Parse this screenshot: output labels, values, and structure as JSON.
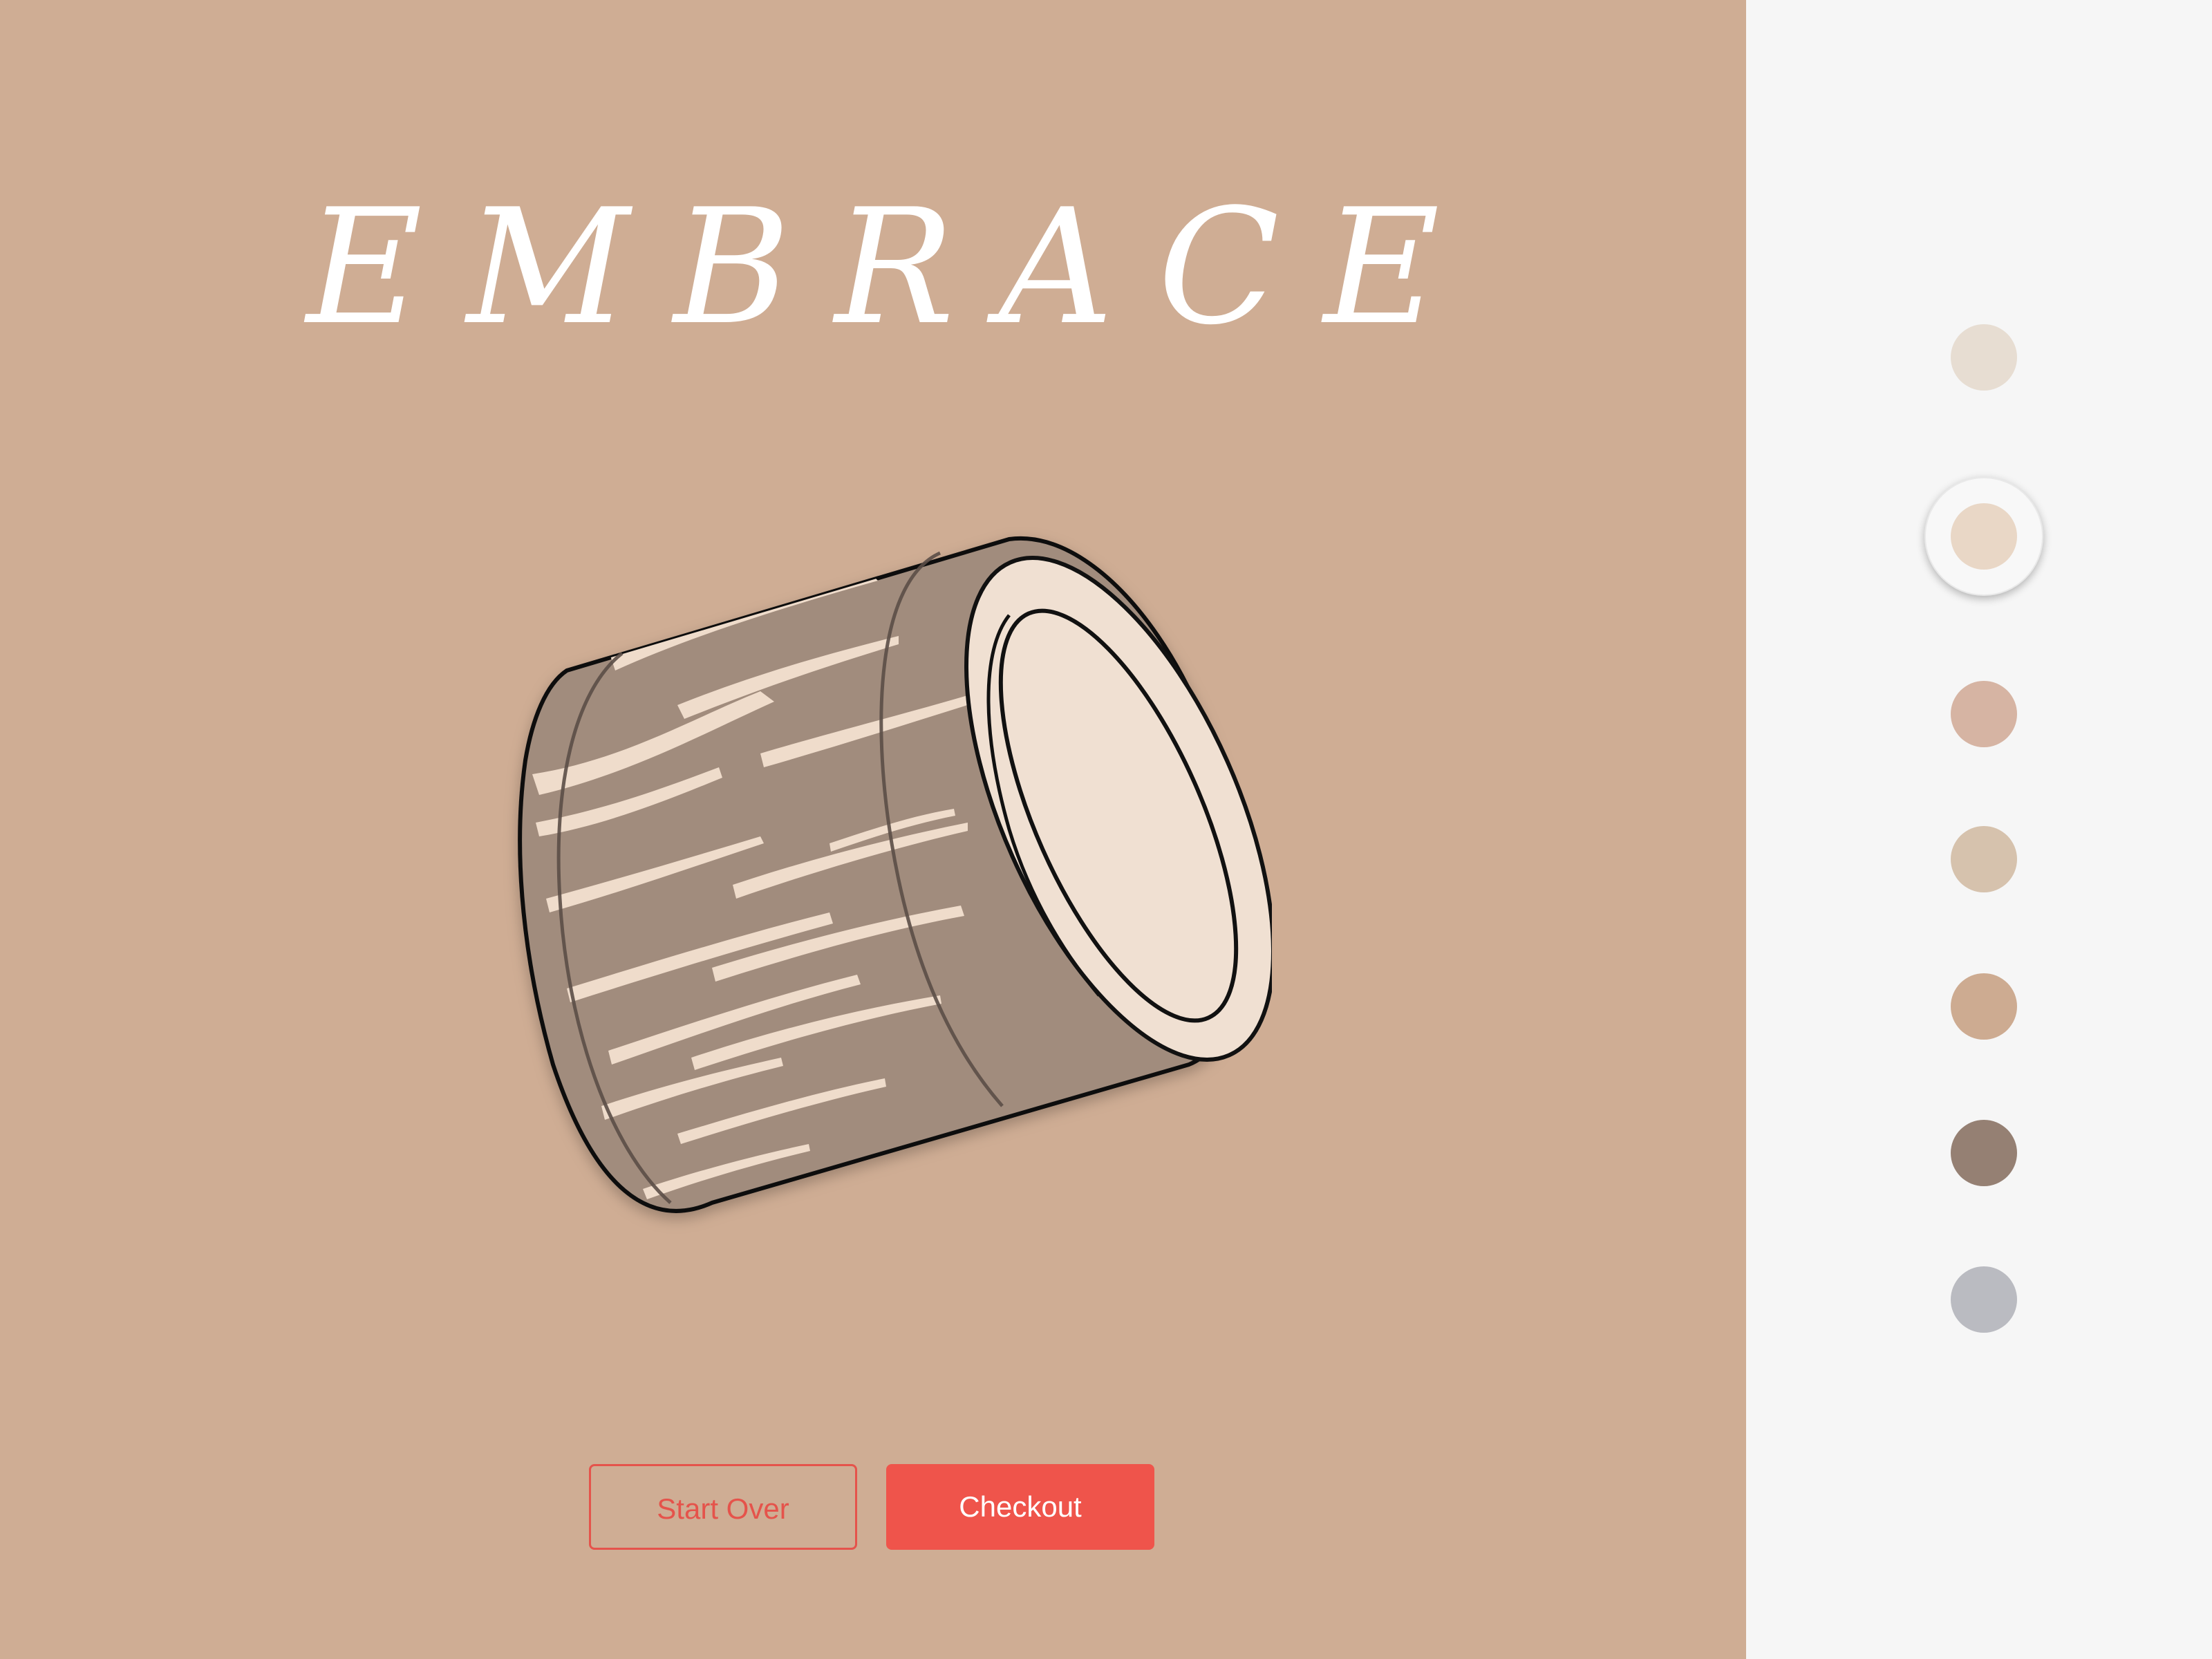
{
  "header": {
    "title": "EMBRACE"
  },
  "product": {
    "name": "ring-preview",
    "colors": {
      "band_outer": "#a18c7d",
      "band_inner": "#f0e0d2",
      "stroke": "#111111",
      "streak": "#efdccb"
    }
  },
  "actions": {
    "start_over_label": "Start Over",
    "checkout_label": "Checkout"
  },
  "theme": {
    "background": "#cfad94",
    "sidebar": "#f6f6f6",
    "accent": "#ef544b"
  },
  "swatches": [
    {
      "color": "#e7ddd2",
      "selected": false
    },
    {
      "color": "#e9d7c6",
      "selected": true
    },
    {
      "color": "#d6b4a3",
      "selected": false
    },
    {
      "color": "#d6c2ad",
      "selected": false
    },
    {
      "color": "#cdab91",
      "selected": false
    },
    {
      "color": "#958073",
      "selected": false
    },
    {
      "color": "#babbc1",
      "selected": false
    }
  ]
}
